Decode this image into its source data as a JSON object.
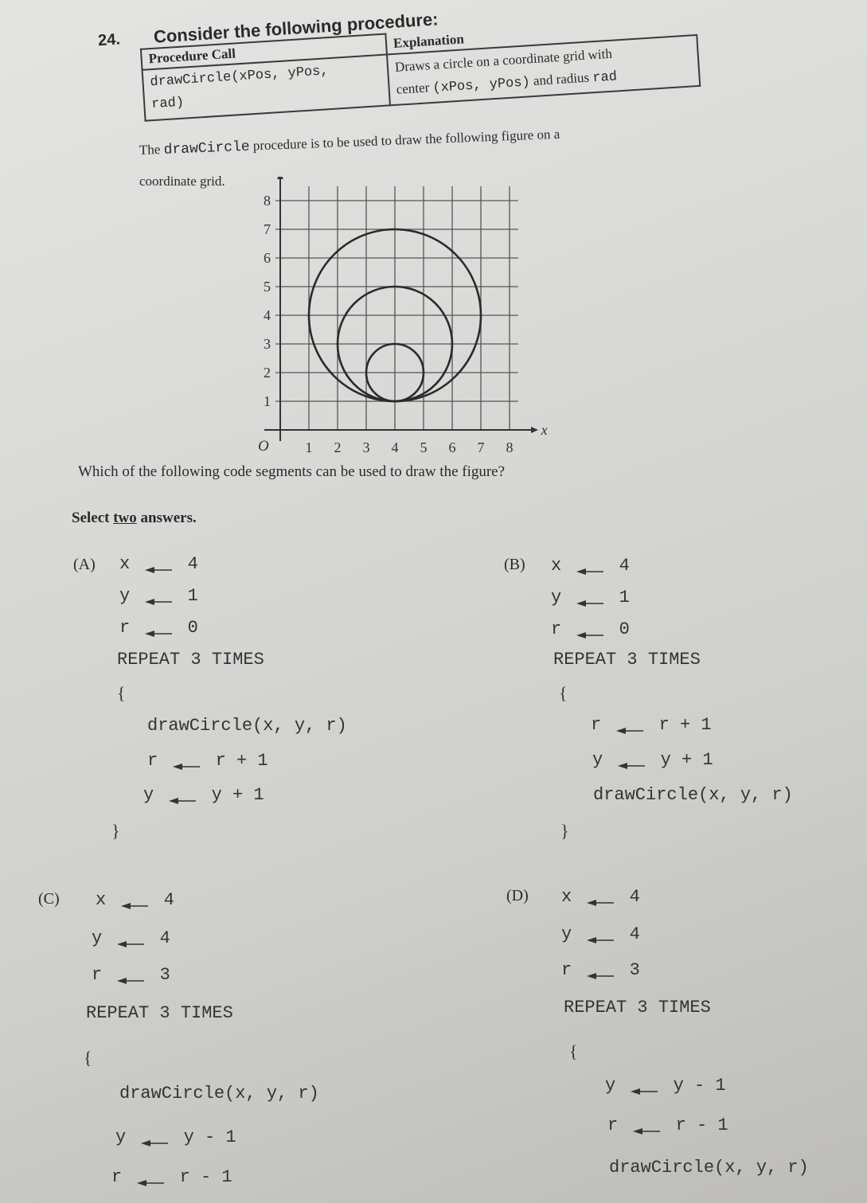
{
  "question": {
    "number": "24.",
    "title": "Consider the following procedure:",
    "table": {
      "headers": [
        "Procedure Call",
        "Explanation"
      ],
      "call_line1": "drawCircle(xPos, yPos,",
      "call_line2": "rad)",
      "explanation_line1": "Draws a circle on a coordinate grid with",
      "explanation_line2_pre": "center",
      "explanation_line2_code": "(xPos, yPos)",
      "explanation_line2_mid": "and radius",
      "explanation_line2_code2": "rad"
    },
    "intro_pre": "The",
    "intro_code": "drawCircle",
    "intro_post": "procedure is to be used to draw the following figure on a",
    "intro_line2": "coordinate grid.",
    "prompt": "Which of the following code segments can be used to draw the figure?",
    "select_pre": "Select",
    "select_emph": "two",
    "select_post": "answers."
  },
  "chart_data": {
    "type": "scatter",
    "title": "",
    "xlabel": "x",
    "ylabel": "y",
    "origin_label": "O",
    "xlim": [
      0,
      8
    ],
    "ylim": [
      0,
      8
    ],
    "x_ticks": [
      "1",
      "2",
      "3",
      "4",
      "5",
      "6",
      "7",
      "8"
    ],
    "y_ticks": [
      "1",
      "2",
      "3",
      "4",
      "5",
      "6",
      "7",
      "8"
    ],
    "grid": true,
    "circles": [
      {
        "cx": 4,
        "cy": 4,
        "r": 3
      },
      {
        "cx": 4,
        "cy": 3,
        "r": 2
      },
      {
        "cx": 4,
        "cy": 2,
        "r": 1
      }
    ]
  },
  "options": [
    {
      "label": "(A)",
      "lines": [
        {
          "lhs": "x",
          "rhs": "4",
          "assign": true
        },
        {
          "lhs": "y",
          "rhs": "1",
          "assign": true
        },
        {
          "lhs": "r",
          "rhs": "0",
          "assign": true
        },
        {
          "text": "REPEAT 3 TIMES"
        },
        {
          "text": "{"
        },
        {
          "text": "drawCircle(x, y, r)"
        },
        {
          "lhs": "r",
          "rhs": "r + 1",
          "assign": true
        },
        {
          "lhs": "y",
          "rhs": "y + 1",
          "assign": true
        },
        {
          "text": "}"
        }
      ]
    },
    {
      "label": "(B)",
      "lines": [
        {
          "lhs": "x",
          "rhs": "4",
          "assign": true
        },
        {
          "lhs": "y",
          "rhs": "1",
          "assign": true
        },
        {
          "lhs": "r",
          "rhs": "0",
          "assign": true
        },
        {
          "text": "REPEAT 3 TIMES"
        },
        {
          "text": "{"
        },
        {
          "lhs": "r",
          "rhs": "r + 1",
          "assign": true
        },
        {
          "lhs": "y",
          "rhs": "y + 1",
          "assign": true
        },
        {
          "text": "drawCircle(x, y, r)"
        },
        {
          "text": "}"
        }
      ]
    },
    {
      "label": "(C)",
      "lines": [
        {
          "lhs": "x",
          "rhs": "4",
          "assign": true
        },
        {
          "lhs": "y",
          "rhs": "4",
          "assign": true
        },
        {
          "lhs": "r",
          "rhs": "3",
          "assign": true
        },
        {
          "text": "REPEAT 3 TIMES"
        },
        {
          "text": "{"
        },
        {
          "text": "drawCircle(x, y, r)"
        },
        {
          "lhs": "y",
          "rhs": "y - 1",
          "assign": true
        },
        {
          "lhs": "r",
          "rhs": "r - 1",
          "assign": true
        }
      ]
    },
    {
      "label": "(D)",
      "lines": [
        {
          "lhs": "x",
          "rhs": "4",
          "assign": true
        },
        {
          "lhs": "y",
          "rhs": "4",
          "assign": true
        },
        {
          "lhs": "r",
          "rhs": "3",
          "assign": true
        },
        {
          "text": "REPEAT 3 TIMES"
        },
        {
          "text": "{"
        },
        {
          "lhs": "y",
          "rhs": "y - 1",
          "assign": true
        },
        {
          "lhs": "r",
          "rhs": "r - 1",
          "assign": true
        },
        {
          "text": "drawCircle(x, y, r)"
        }
      ]
    }
  ]
}
